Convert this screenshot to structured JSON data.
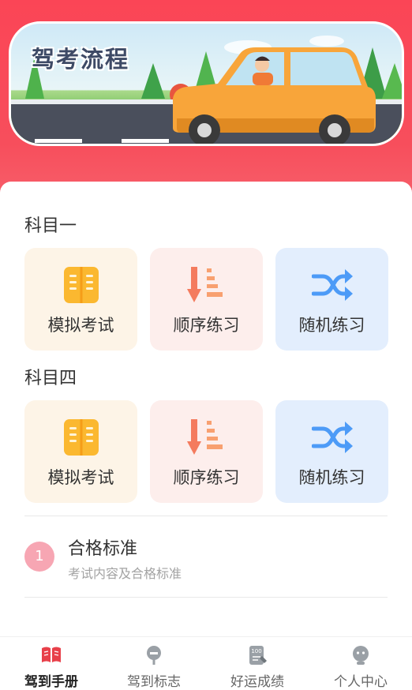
{
  "banner": {
    "title": "驾考流程"
  },
  "sections": [
    {
      "title": "科目一",
      "tiles": [
        {
          "label": "模拟考试",
          "icon": "book-icon"
        },
        {
          "label": "顺序练习",
          "icon": "sort-order-icon"
        },
        {
          "label": "随机练习",
          "icon": "shuffle-icon"
        }
      ]
    },
    {
      "title": "科目四",
      "tiles": [
        {
          "label": "模拟考试",
          "icon": "book-icon"
        },
        {
          "label": "顺序练习",
          "icon": "sort-order-icon"
        },
        {
          "label": "随机练习",
          "icon": "shuffle-icon"
        }
      ]
    }
  ],
  "standard": {
    "number": "1",
    "title": "合格标准",
    "subtitle": "考试内容及合格标准"
  },
  "tabbar": [
    {
      "label": "驾到手册",
      "icon": "open-book-icon",
      "active": true
    },
    {
      "label": "驾到标志",
      "icon": "sign-post-icon",
      "active": false
    },
    {
      "label": "好运成绩",
      "icon": "score-sheet-icon",
      "active": false
    },
    {
      "label": "个人中心",
      "icon": "person-icon",
      "active": false
    }
  ],
  "colors": {
    "header_red": "#fb4556",
    "exam_tile_bg": "#fdf4e7",
    "sequence_tile_bg": "#fdeeec",
    "random_tile_bg": "#e3eefd",
    "book_icon": "#fbb830",
    "sequence_icon": "#f47b5e",
    "shuffle_icon": "#4d9bf7",
    "badge_pink": "#f7a6b3",
    "active_tab_icon": "#e8404a",
    "inactive_tab_icon": "#9aa0a6"
  }
}
